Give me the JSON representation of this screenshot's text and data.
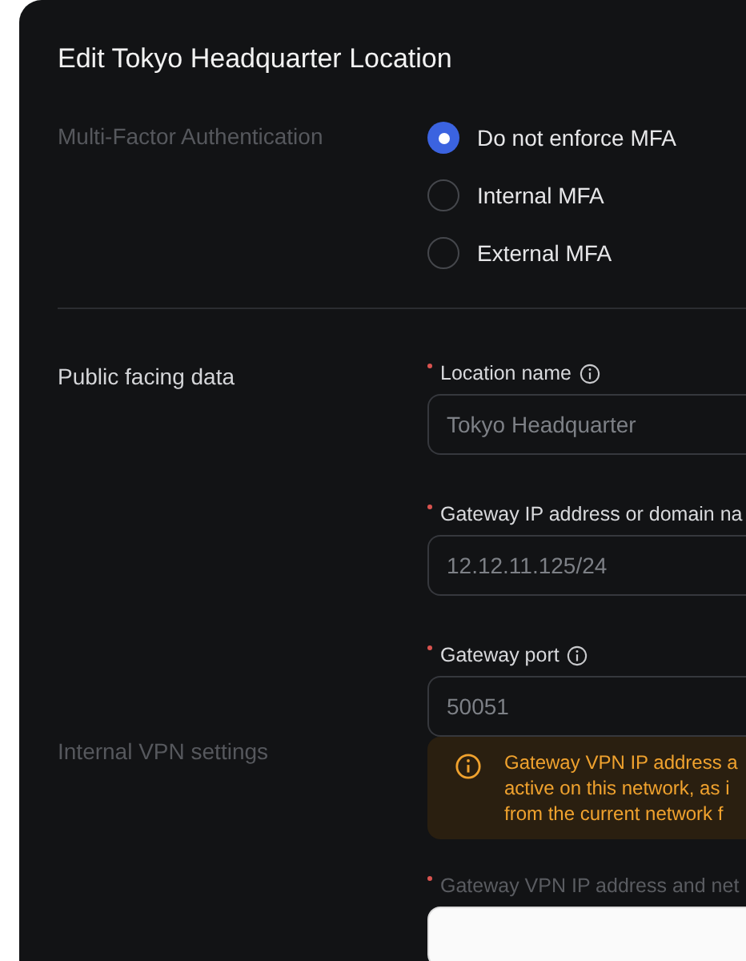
{
  "dialog": {
    "title": "Edit Tokyo Headquarter Location"
  },
  "sections": [
    {
      "label": "Multi-Factor Authentication",
      "disabled": true,
      "radios": [
        {
          "label": "Do not enforce MFA",
          "selected": true
        },
        {
          "label": "Internal MFA",
          "selected": false
        },
        {
          "label": "External MFA",
          "selected": false
        }
      ]
    },
    {
      "label": "Public facing data",
      "disabled": false,
      "fields": [
        {
          "label": "Location name",
          "required": true,
          "info": true,
          "value": "Tokyo Headquarter"
        },
        {
          "label": "Gateway IP address or domain na",
          "required": true,
          "info": false,
          "value": "12.12.11.125/24"
        },
        {
          "label": "Gateway port",
          "required": true,
          "info": true,
          "value": "50051"
        }
      ]
    },
    {
      "label": "Internal VPN settings",
      "disabled": true,
      "alert": {
        "lines": [
          "Gateway VPN IP address a",
          "active on this network, as i",
          "from the current network f"
        ]
      },
      "fields": [
        {
          "label": "Gateway VPN IP address and net",
          "required": true,
          "info": false,
          "disabled": true
        }
      ]
    }
  ]
}
